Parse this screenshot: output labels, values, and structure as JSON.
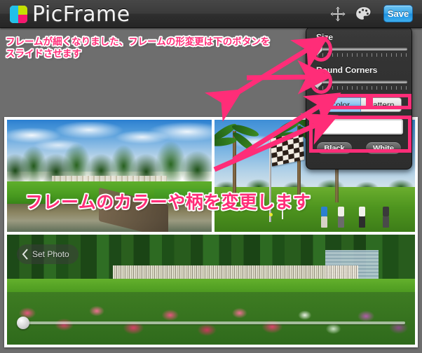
{
  "app": {
    "title": "PicFrame",
    "logo_colors": {
      "cyan": "#22c0e8",
      "lime": "#c3e000",
      "pink": "#f5176e"
    }
  },
  "topbar": {
    "title": "PicFrame",
    "move_icon": "move-arrows-icon",
    "palette_icon": "palette-icon",
    "save_label": "Save",
    "save_color": "#38a4e8"
  },
  "panel": {
    "size_label": "Size",
    "round_corners_label": "Round Corners",
    "size_value": 0,
    "round_corners_value": 0,
    "segmented": {
      "options": [
        "Color",
        "Pattern"
      ],
      "selected": "Color"
    },
    "swatch_color": "#ffffff",
    "buttons": [
      {
        "label": "Black"
      },
      {
        "label": "White"
      }
    ]
  },
  "collage": {
    "frame_color": "#ffffff",
    "set_photo_label": "Set Photo",
    "back_chevron_icon": "chevron-left-icon",
    "photos": [
      {
        "name": "golf-fairway-pond-photo",
        "position": "top-left"
      },
      {
        "name": "palm-trees-chequered-flag-photo",
        "position": "top-right"
      },
      {
        "name": "azalea-garden-crowd-photo",
        "position": "bottom"
      }
    ],
    "scrub_value": 0
  },
  "annotations": {
    "accent_color": "#ff2d78",
    "outline_color": "#ffffff",
    "top_text": "フレームが細くなりました、フレームの形変更は下のボタンを\nスライドさせます",
    "middle_text": "フレームのカラーや柄を変更します",
    "shapes": [
      {
        "type": "ellipse",
        "target": "size-slider-thumb"
      },
      {
        "type": "ellipse",
        "target": "round-corners-slider-thumb"
      },
      {
        "type": "rect",
        "target": "color-segment"
      },
      {
        "type": "rect",
        "target": "pattern-segment"
      },
      {
        "type": "rect",
        "target": "swatch-and-bw-buttons"
      },
      {
        "type": "double-arrow",
        "target": "two-sliders"
      },
      {
        "type": "arrow",
        "target": "color-pattern-buttons"
      },
      {
        "type": "arrow",
        "target": "color-swatch"
      }
    ]
  }
}
